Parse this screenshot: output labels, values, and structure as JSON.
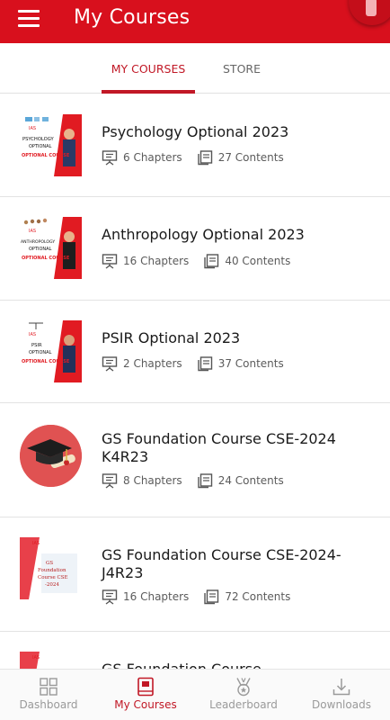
{
  "appbar": {
    "title": "My Courses",
    "menu_icon": "hamburger-menu-icon"
  },
  "tabs": [
    {
      "label": "MY COURSES",
      "active": true
    },
    {
      "label": "STORE",
      "active": false
    }
  ],
  "courses": [
    {
      "title": "Psychology Optional 2023",
      "chapters": "6 Chapters",
      "contents": "27 Contents",
      "thumb_lines": [
        "PSYCHOLOGY",
        "OPTIONAL",
        "OPTIONAL COURSE"
      ]
    },
    {
      "title": "Anthropology Optional 2023",
      "chapters": "16 Chapters",
      "contents": "40 Contents",
      "thumb_lines": [
        "ANTHROPOLOGY",
        "OPTIONAL",
        "OPTIONAL COURSE"
      ]
    },
    {
      "title": "PSIR Optional 2023",
      "chapters": "2 Chapters",
      "contents": "37 Contents",
      "thumb_lines": [
        "PSIR",
        "OPTIONAL",
        "OPTIONAL COURSE"
      ]
    },
    {
      "title": "GS Foundation Course CSE-2024 K4R23",
      "chapters": "8 Chapters",
      "contents": "24 Contents"
    },
    {
      "title": "GS Foundation Course CSE-2024-J4R23",
      "chapters": "16 Chapters",
      "contents": "72 Contents",
      "thumb_lines": [
        "GS",
        "Foundation",
        "Course CSE",
        "-2024"
      ]
    },
    {
      "title": "GS Foundation Course"
    }
  ],
  "brand_label": "IAS",
  "bottom_nav": [
    {
      "label": "Dashboard",
      "icon": "dashboard-grid-icon",
      "active": false
    },
    {
      "label": "My Courses",
      "icon": "book-icon",
      "active": true
    },
    {
      "label": "Leaderboard",
      "icon": "medal-icon",
      "active": false
    },
    {
      "label": "Downloads",
      "icon": "download-icon",
      "active": false
    }
  ],
  "colors": {
    "brand_red": "#d8101d",
    "active_tab": "#c11826",
    "meta_text": "#5b5b5b"
  }
}
